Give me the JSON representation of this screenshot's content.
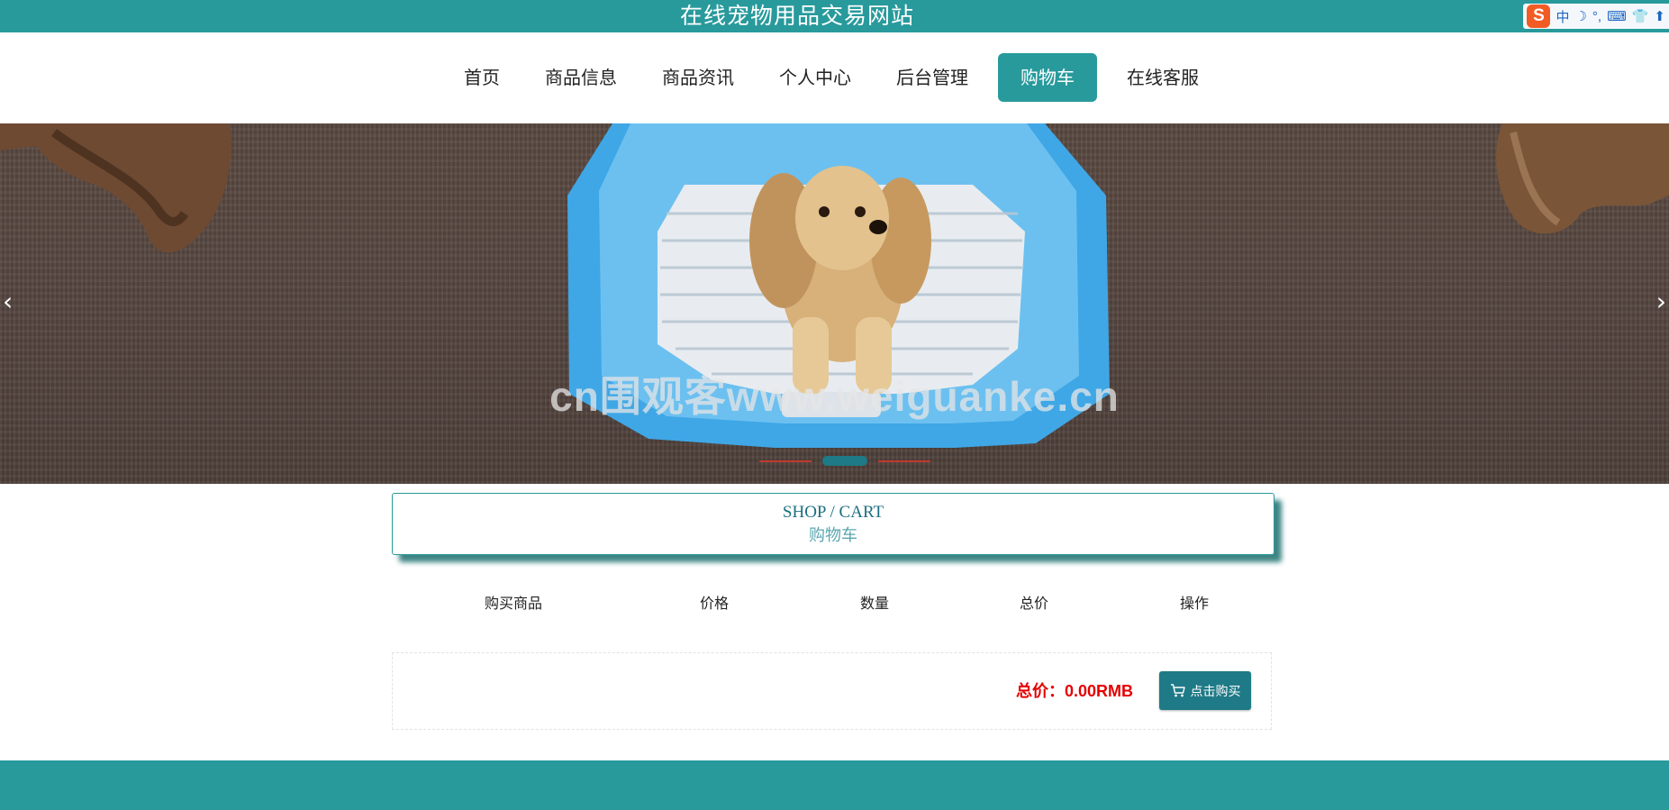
{
  "header": {
    "site_title": "在线宠物用品交易网站"
  },
  "ime": {
    "logo": "S",
    "items": [
      "中",
      "☽",
      "°,",
      "⌨",
      "👕",
      "⬆"
    ]
  },
  "nav": {
    "items": [
      {
        "label": "首页"
      },
      {
        "label": "商品信息"
      },
      {
        "label": "商品资讯"
      },
      {
        "label": "个人中心"
      },
      {
        "label": "后台管理"
      },
      {
        "label": "购物车",
        "active": true
      },
      {
        "label": "在线客服"
      }
    ]
  },
  "banner": {
    "prev_glyph": "‹",
    "next_glyph": "›",
    "watermark": "cn围观客www.weiguanke.cn"
  },
  "cart": {
    "title_en": "SHOP / CART",
    "title_zh": "购物车",
    "columns": [
      "购买商品",
      "价格",
      "数量",
      "总价",
      "操作"
    ],
    "total_text": "总价：0.00RMB",
    "buy_label": "点击购买"
  },
  "colors": {
    "primary": "#289a9c",
    "button": "#1f7a87",
    "total": "#e60000"
  }
}
